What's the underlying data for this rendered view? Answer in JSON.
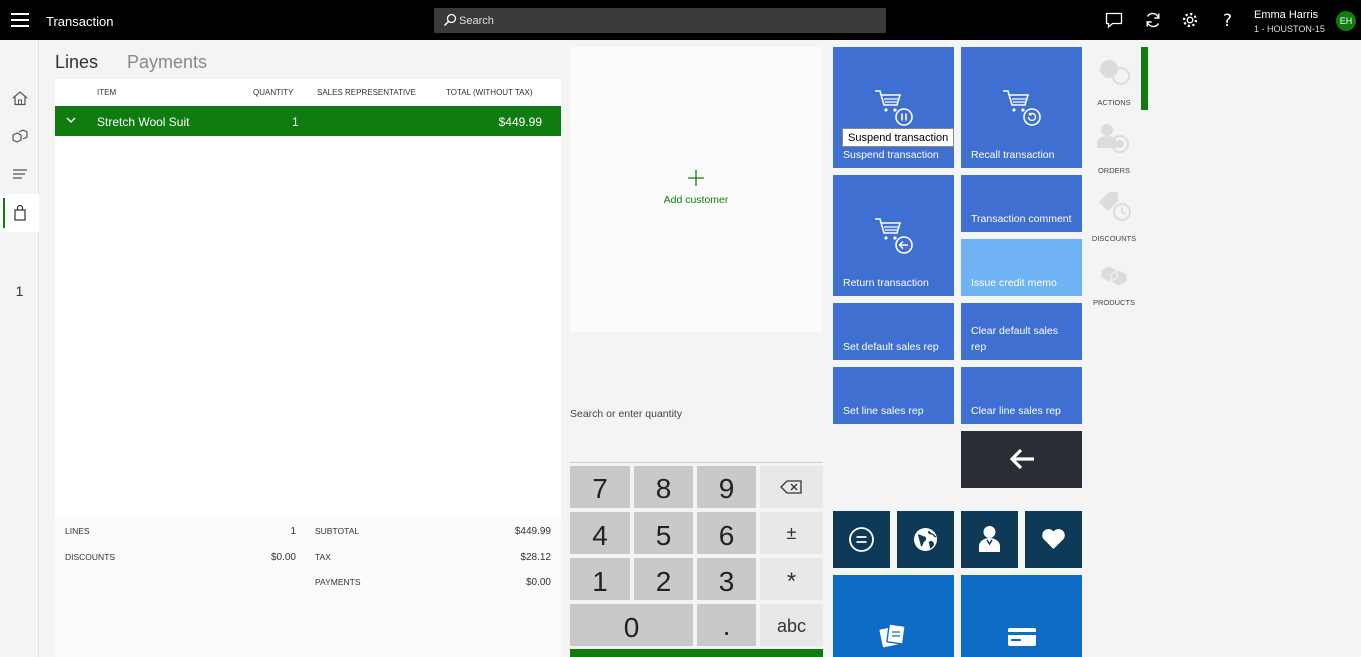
{
  "header": {
    "title": "Transaction",
    "search_placeholder": "Search",
    "user_name": "Emma Harris",
    "user_store": "1 - HOUSTON-15",
    "avatar_initials": "EH"
  },
  "rail": {
    "cart_count": "1"
  },
  "tabs": {
    "lines": "Lines",
    "payments": "Payments"
  },
  "grid": {
    "columns": {
      "item": "ITEM",
      "quantity": "QUANTITY",
      "sales_rep": "SALES REPRESENTATIVE",
      "total": "TOTAL (WITHOUT TAX)"
    },
    "rows": [
      {
        "item": "Stretch Wool Suit",
        "quantity": "1",
        "sales_rep": "",
        "total": "$449.99"
      }
    ]
  },
  "totals": {
    "lines_label": "LINES",
    "lines_value": "1",
    "discounts_label": "DISCOUNTS",
    "discounts_value": "$0.00",
    "subtotal_label": "SUBTOTAL",
    "subtotal_value": "$449.99",
    "tax_label": "TAX",
    "tax_value": "$28.12",
    "payments_label": "PAYMENTS",
    "payments_value": "$0.00"
  },
  "customer": {
    "add_label": "Add customer"
  },
  "numpad": {
    "placeholder": "Search or enter quantity",
    "keys": {
      "k7": "7",
      "k8": "8",
      "k9": "9",
      "k4": "4",
      "k5": "5",
      "k6": "6",
      "k1": "1",
      "k2": "2",
      "k3": "3",
      "k0": "0",
      "dot": ".",
      "plusminus": "±",
      "multiply": "*",
      "abc": "abc"
    }
  },
  "tiles": {
    "suspend": "Suspend transaction",
    "recall": "Recall transaction",
    "return": "Return transaction",
    "comment": "Transaction comment",
    "credit_memo": "Issue credit memo",
    "set_default_rep": "Set default sales rep",
    "clear_default_rep": "Clear default sales rep",
    "set_line_rep": "Set line sales rep",
    "clear_line_rep": "Clear line sales rep",
    "tooltip": "Suspend transaction"
  },
  "right_rail": {
    "actions": "ACTIONS",
    "orders": "ORDERS",
    "discounts": "DISCOUNTS",
    "products": "PRODUCTS"
  },
  "colors": {
    "accent": "#107c10",
    "tile": "#3e6fd1",
    "tile_light": "#6fb3f5",
    "tile_dark": "#2b2d36",
    "tile_navy": "#0e3a57",
    "tile_blue": "#0f6cc6"
  }
}
